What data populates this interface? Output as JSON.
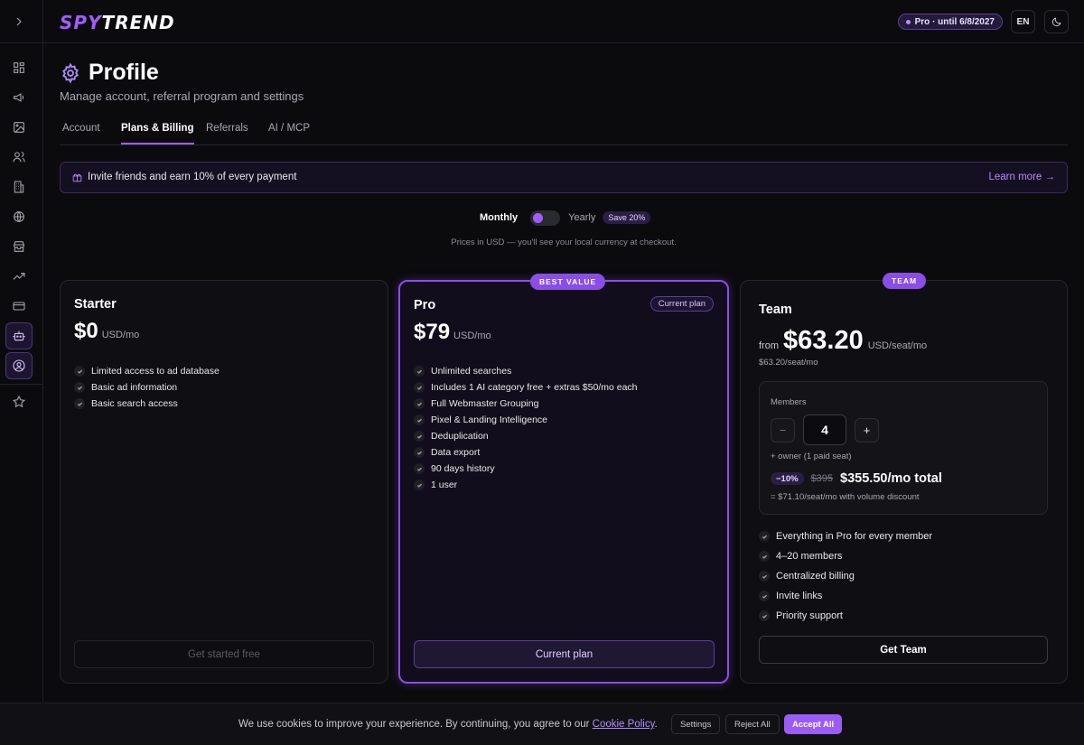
{
  "topbar": {
    "logo_part1": "SPY",
    "logo_part2": "TREND",
    "pro_badge": "Pro · until 6/8/2027",
    "lang": "EN"
  },
  "sidebar": {
    "items": [
      {
        "icon": "dashboard-icon"
      },
      {
        "icon": "megaphone-icon"
      },
      {
        "icon": "image-icon"
      },
      {
        "icon": "users-icon"
      },
      {
        "icon": "building-icon"
      },
      {
        "icon": "globe-icon"
      },
      {
        "icon": "store-icon"
      },
      {
        "icon": "trending-icon"
      },
      {
        "icon": "credit-card-icon"
      },
      {
        "icon": "bot-icon"
      },
      {
        "icon": "user-circle-icon"
      },
      {
        "icon": "star-icon"
      }
    ]
  },
  "header": {
    "title": "Profile",
    "subtitle": "Manage account, referral program and settings"
  },
  "tabs": [
    {
      "label": "Account",
      "active": false
    },
    {
      "label": "Plans & Billing",
      "active": true
    },
    {
      "label": "Referrals",
      "active": false
    },
    {
      "label": "AI / MCP",
      "active": false
    }
  ],
  "invite": {
    "text": "Invite friends and earn 10% of every payment",
    "link": "Learn more →"
  },
  "billing": {
    "monthly": "Monthly",
    "yearly": "Yearly",
    "save": "Save 20%",
    "note": "Prices in USD — you'll see your local currency at checkout."
  },
  "plans": {
    "starter": {
      "name": "Starter",
      "price": "$0",
      "unit": "USD/mo",
      "features": [
        "Limited access to ad database",
        "Basic ad information",
        "Basic search access"
      ],
      "cta": "Get started free"
    },
    "pro": {
      "badge": "BEST VALUE",
      "name": "Pro",
      "current_badge": "Current plan",
      "price": "$79",
      "unit": "USD/mo",
      "features": [
        "Unlimited searches",
        "Includes 1 AI category free + extras $50/mo each",
        "Full Webmaster Grouping",
        "Pixel & Landing Intelligence",
        "Deduplication",
        "Data export",
        "90 days history",
        "1 user"
      ],
      "cta": "Current plan"
    },
    "team": {
      "badge": "TEAM",
      "name": "Team",
      "from": "from",
      "price": "$63.20",
      "unit": "USD/seat/mo",
      "sub": "$63.20/seat/mo",
      "members_label": "Members",
      "members_value": "4",
      "minus": "−",
      "plus": "+",
      "owner_note": "+ owner (1 paid seat)",
      "discount": "−10%",
      "orig_price": "$395",
      "total": "$355.50/mo total",
      "per_seat": "= $71.10/seat/mo with volume discount",
      "features": [
        "Everything in Pro for every member",
        "4–20 members",
        "Centralized billing",
        "Invite links",
        "Priority support"
      ],
      "cta": "Get Team"
    }
  },
  "cookie": {
    "text": "We use cookies to improve your experience. By continuing, you agree to our",
    "link": "Cookie Policy",
    "period": ".",
    "settings": "Settings",
    "reject": "Reject All",
    "accept": "Accept All"
  },
  "colors": {
    "accent": "#a25cff",
    "background": "#0b0b0e"
  }
}
